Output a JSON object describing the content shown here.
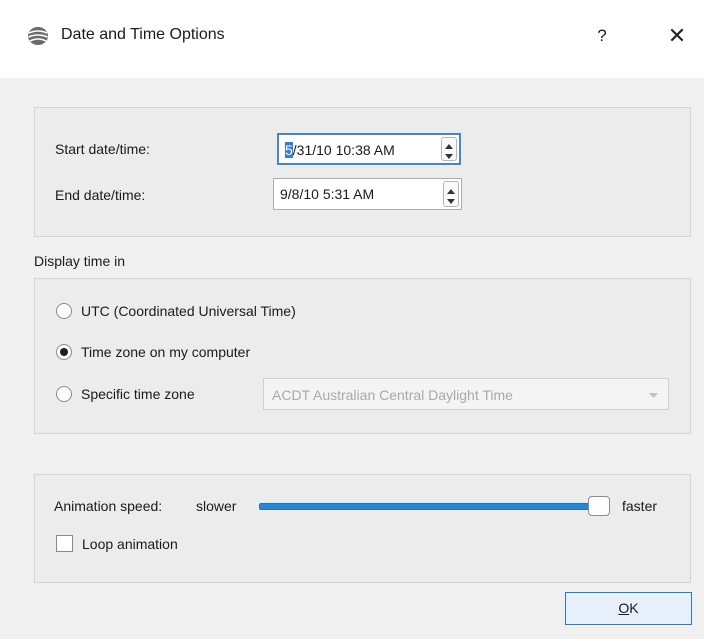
{
  "window": {
    "title": "Date and Time Options",
    "help_label": "?",
    "close_label": "✕"
  },
  "dates": {
    "start_label": "Start date/time:",
    "start_value_selected": "5",
    "start_value_rest": "/31/10 10:38 AM",
    "end_label": "End date/time:",
    "end_value": "9/8/10 5:31 AM"
  },
  "display": {
    "section_label": "Display time in",
    "options": [
      {
        "label": "UTC (Coordinated Universal Time)",
        "checked": false
      },
      {
        "label": "Time zone on my computer",
        "checked": true
      },
      {
        "label": "Specific time zone",
        "checked": false
      }
    ],
    "timezone_value": "ACDT Australian Central Daylight Time"
  },
  "animation": {
    "speed_label": "Animation speed:",
    "slower_label": "slower",
    "faster_label": "faster",
    "speed_fraction": 1.0,
    "loop_label": "Loop animation",
    "loop_checked": false
  },
  "buttons": {
    "ok_mnemonic": "O",
    "ok_rest": "K"
  },
  "colors": {
    "accent": "#2f86d0",
    "focus_border": "#4a86c7"
  }
}
